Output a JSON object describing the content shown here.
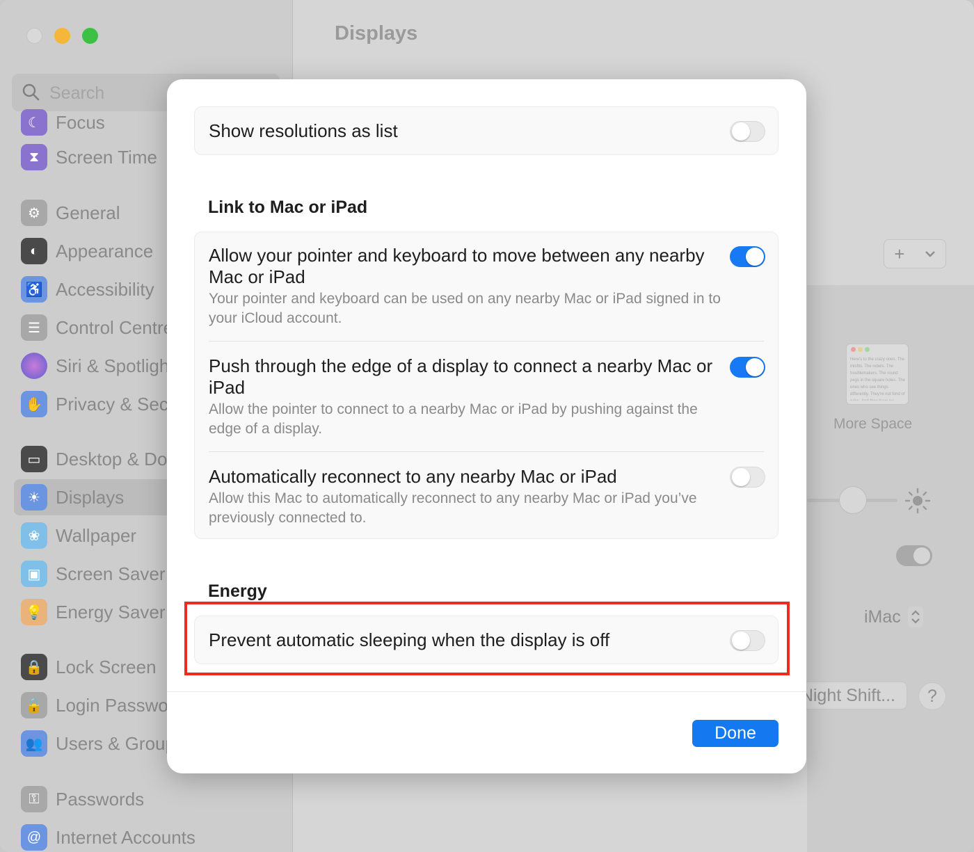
{
  "window": {
    "title": "Displays",
    "traffic_lights": {
      "close": "#d9d9d9",
      "minimize": "#f4b73a",
      "maximize": "#3cc145"
    }
  },
  "sidebar": {
    "search_placeholder": "Search",
    "items": [
      {
        "label": "Focus",
        "icon": "focus-icon",
        "color": "#7a5bd6"
      },
      {
        "label": "Screen Time",
        "icon": "hourglass-icon",
        "color": "#7a5bd6"
      },
      {
        "label": "General",
        "icon": "gear-icon",
        "color": "#9a9a9a"
      },
      {
        "label": "Appearance",
        "icon": "appearance-icon",
        "color": "#2b2b2b"
      },
      {
        "label": "Accessibility",
        "icon": "accessibility-icon",
        "color": "#2f7df6"
      },
      {
        "label": "Control Centre",
        "icon": "control-centre-icon",
        "color": "#9a9a9a"
      },
      {
        "label": "Siri & Spotlight",
        "icon": "siri-icon",
        "color": "#8c3bd9"
      },
      {
        "label": "Privacy & Security",
        "icon": "hand-icon",
        "color": "#2f7df6"
      },
      {
        "label": "Desktop & Dock",
        "icon": "dock-icon",
        "color": "#2b2b2b"
      },
      {
        "label": "Displays",
        "icon": "sun-icon",
        "color": "#2f7df6",
        "selected": true
      },
      {
        "label": "Wallpaper",
        "icon": "flower-icon",
        "color": "#3bb2f6"
      },
      {
        "label": "Screen Saver",
        "icon": "screen-saver-icon",
        "color": "#3bb2f6"
      },
      {
        "label": "Energy Saver",
        "icon": "battery-bulb-icon",
        "color": "#f4a13a"
      },
      {
        "label": "Lock Screen",
        "icon": "lock-icon",
        "color": "#2b2b2b"
      },
      {
        "label": "Login Password",
        "icon": "padlock-icon",
        "color": "#9a9a9a"
      },
      {
        "label": "Users & Groups",
        "icon": "users-icon",
        "color": "#2f7df6"
      },
      {
        "label": "Passwords",
        "icon": "key-icon",
        "color": "#9a9a9a"
      },
      {
        "label": "Internet Accounts",
        "icon": "at-icon",
        "color": "#2f7df6"
      }
    ]
  },
  "background": {
    "add_button": "+",
    "thumbnail_text": "Here's to the crazy ones. The misfits. The rebels. The troublemakers. The round pegs in the square holes. The ones who see things differently. They're not fond of rules. And they have no respect for the status quo. You can quote them, disagree with them, glorify or vilify them. About the only thing you can't do is ignore them. Because they change things.",
    "more_space_label": "More Space",
    "main_display_value": "iMac",
    "night_shift_label": "Night Shift...",
    "help_label": "?"
  },
  "modal": {
    "show_resolutions": {
      "label": "Show resolutions as list",
      "enabled": false
    },
    "link_section_title": "Link to Mac or iPad",
    "link_rows": [
      {
        "title": "Allow your pointer and keyboard to move between any nearby Mac or iPad",
        "description": "Your pointer and keyboard can be used on any nearby Mac or iPad signed in to your iCloud account.",
        "enabled": true
      },
      {
        "title": "Push through the edge of a display to connect a nearby Mac or iPad",
        "description": "Allow the pointer to connect to a nearby Mac or iPad by pushing against the edge of a display.",
        "enabled": true
      },
      {
        "title": "Automatically reconnect to any nearby Mac or iPad",
        "description": "Allow this Mac to automatically reconnect to any nearby Mac or iPad you’ve previously connected to.",
        "enabled": false
      }
    ],
    "energy_section_title": "Energy",
    "energy_row": {
      "label": "Prevent automatic sleeping when the display is off",
      "enabled": false
    },
    "done_label": "Done",
    "accent_color": "#1779f3",
    "highlight_color": "#ee2b20"
  }
}
